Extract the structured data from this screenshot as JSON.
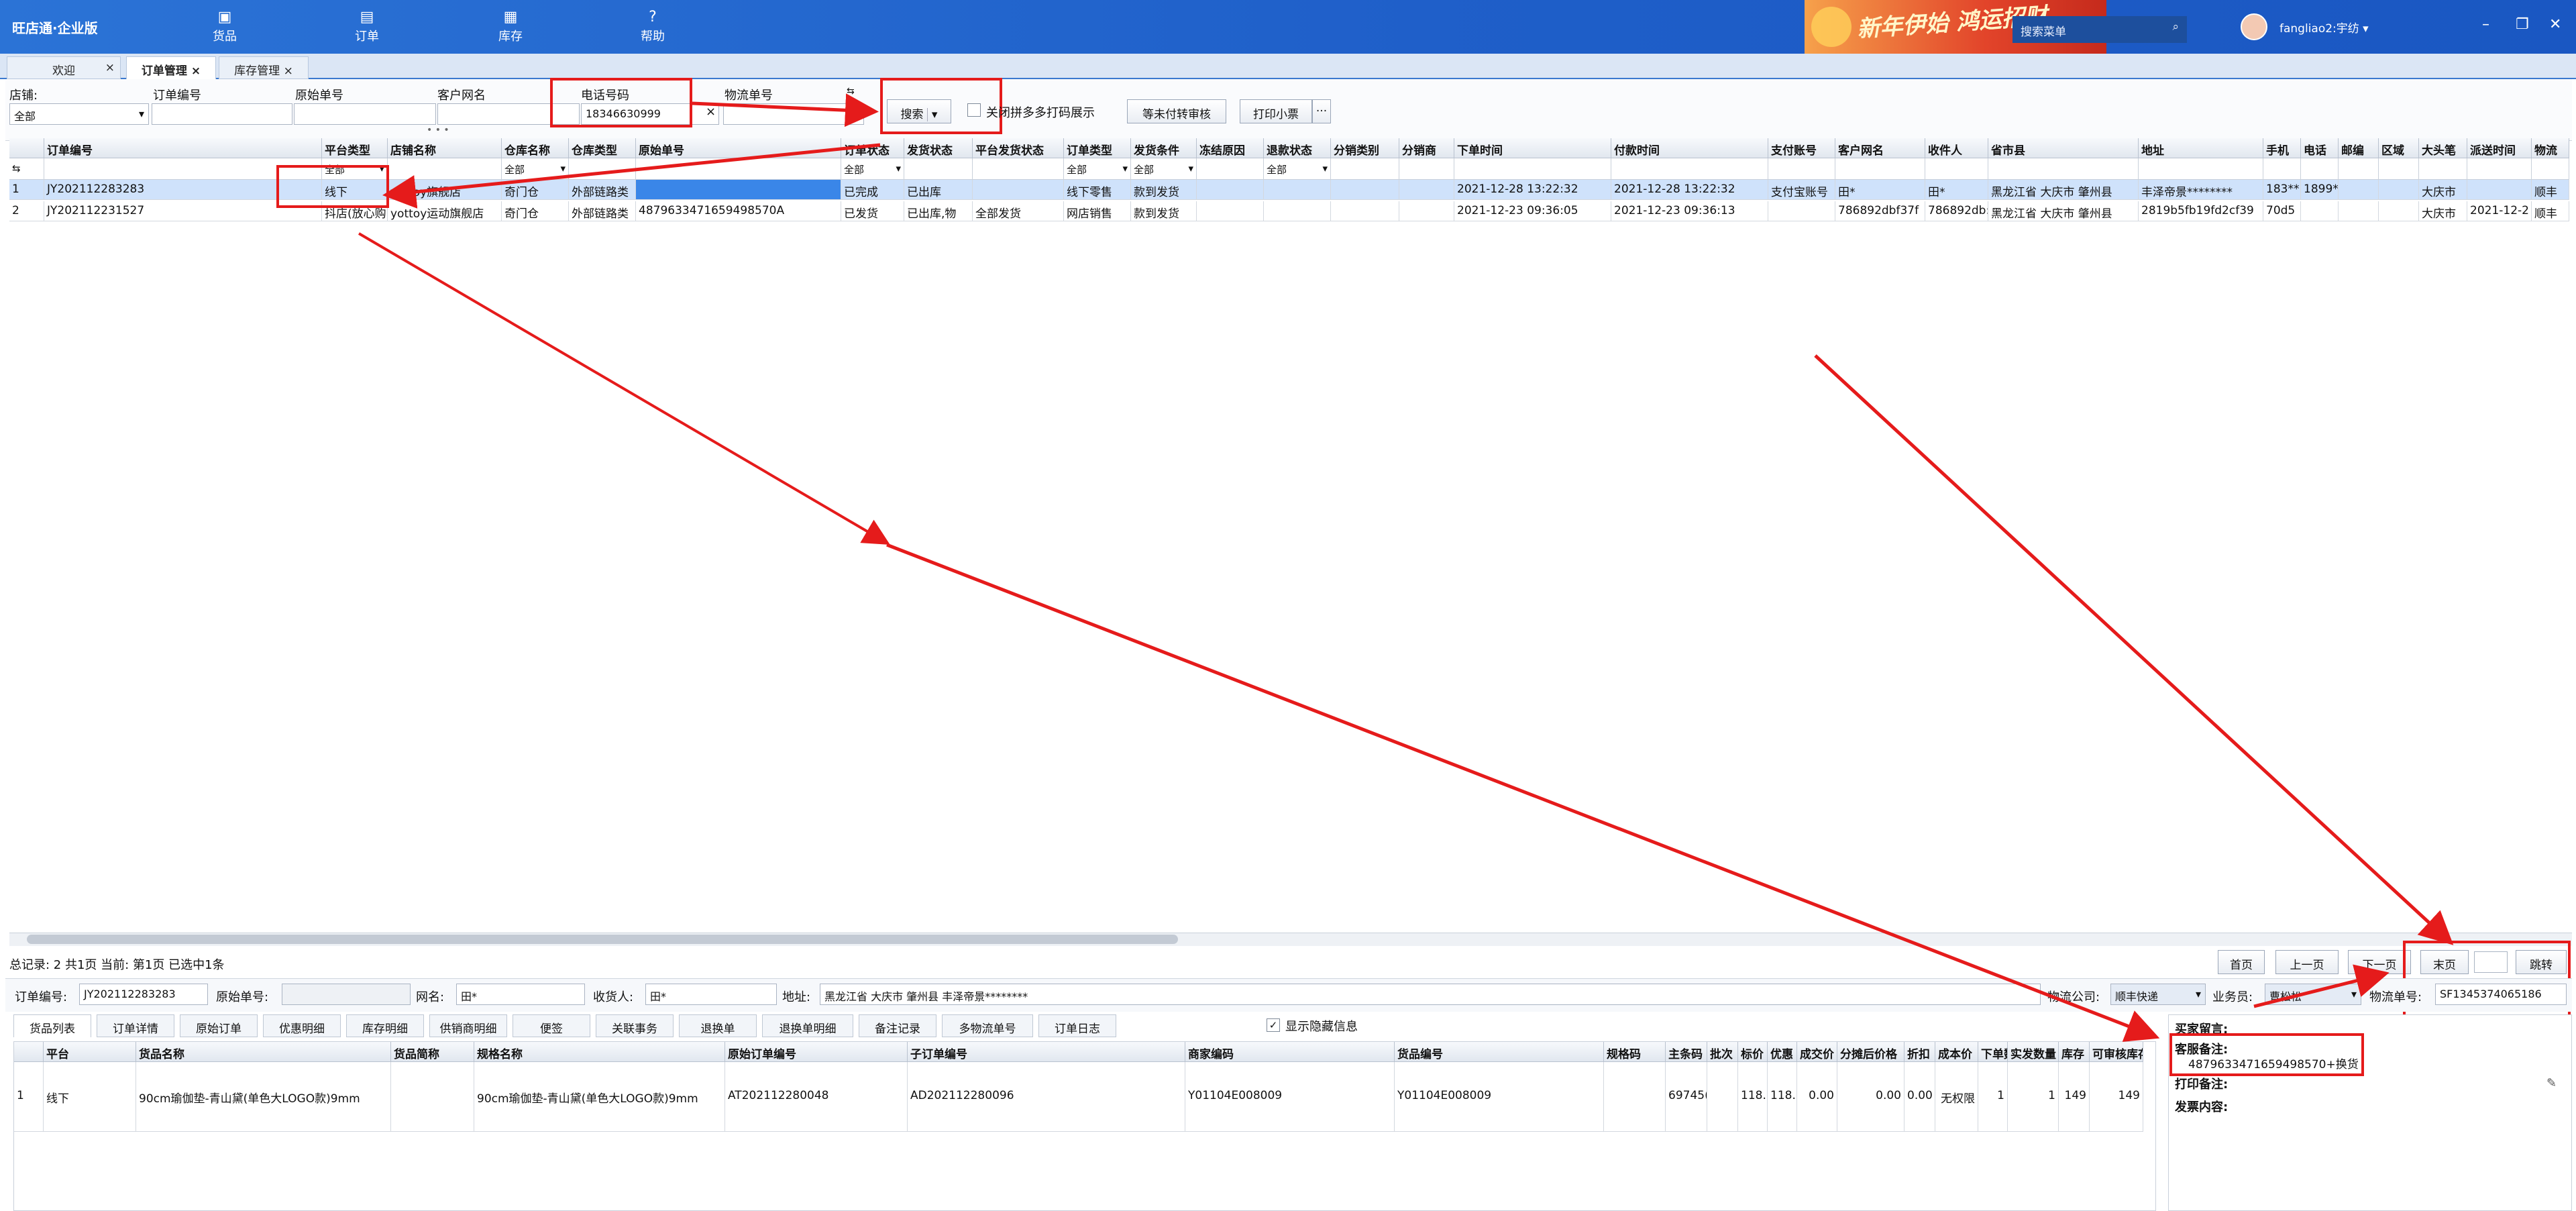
{
  "app": {
    "logo": "旺店通·企业版",
    "nav": [
      {
        "label": "货品",
        "icon": "goods-icon"
      },
      {
        "label": "订单",
        "icon": "order-icon"
      },
      {
        "label": "库存",
        "icon": "stock-icon"
      },
      {
        "label": "帮助",
        "icon": "help-icon"
      }
    ],
    "banner": "新年伊始 鸿运招财",
    "search_placeholder": "搜索菜单",
    "user": "fangliao2:宇纺"
  },
  "tabs": [
    {
      "label": "欢迎"
    },
    {
      "label": "订单管理"
    },
    {
      "label": "库存管理"
    }
  ],
  "filters": {
    "shop_label": "店铺:",
    "shop_value": "全部",
    "order_no_label": "订单编号",
    "orig_no_label": "原始单号",
    "customer_label": "客户网名",
    "phone_label": "电话号码",
    "phone_value": "18346630999",
    "logistics_label": "物流单号",
    "search_btn": "搜索",
    "checkbox_label": "关闭拼多多打码展示",
    "pending_btn": "等未付转审核",
    "print_btn": "打印小票",
    "more_btn": "···"
  },
  "grid": {
    "columns": [
      "订单编号",
      "平台类型",
      "店铺名称",
      "仓库名称",
      "仓库类型",
      "原始单号",
      "订单状态",
      "发货状态",
      "平台发货状态",
      "订单类型",
      "发货条件",
      "冻结原因",
      "退款状态",
      "分销类别",
      "分销商",
      "下单时间",
      "付款时间",
      "支付账号",
      "客户网名",
      "收件人",
      "省市县",
      "地址",
      "手机",
      "电话",
      "邮编",
      "区域",
      "大头笔",
      "派送时间",
      "物流"
    ],
    "filter_all": "全部",
    "rows": [
      [
        "1",
        "JY202112283283",
        "线下",
        "yottoy旗舰店",
        "奇门仓",
        "外部链路类",
        "",
        "已完成",
        "已出库",
        "",
        "线下零售",
        "款到发货",
        "",
        "",
        "",
        "",
        "2021-12-28 13:22:32",
        "2021-12-28 13:22:32",
        "支付宝账号",
        "田*",
        "田*",
        "黑龙江省 大庆市 肇州县",
        "丰泽帝景********",
        "183**",
        "1899*",
        "",
        "",
        "大庆市",
        "",
        "顺丰"
      ],
      [
        "2",
        "JY202112231527",
        "抖店(放心购)",
        "yottoy运动旗舰店",
        "奇门仓",
        "外部链路类",
        "4879633471659498570A",
        "已发货",
        "已出库,物",
        "全部发货",
        "网店销售",
        "款到发货",
        "",
        "",
        "",
        "",
        "2021-12-23 09:36:05",
        "2021-12-23 09:36:13",
        "",
        "786892dbf37f",
        "786892db:",
        "黑龙江省 大庆市 肇州县",
        "2819b5fb19fd2cf39",
        "70d5",
        "",
        "",
        "",
        "大庆市",
        "2021-12-2",
        "顺丰"
      ]
    ]
  },
  "status": {
    "summary": "总记录: 2 共1页 当前: 第1页 已选中1条",
    "first": "首页",
    "prev": "上一页",
    "next": "下一页",
    "last": "末页",
    "jump": "跳转"
  },
  "detail": {
    "order_no_label": "订单编号:",
    "order_no": "JY202112283283",
    "orig_label": "原始单号:",
    "orig": "",
    "net_label": "网名:",
    "net": "田*",
    "recv_label": "收货人:",
    "recv": "田*",
    "addr_label": "地址:",
    "addr": "黑龙江省 大庆市 肇州县 丰泽帝景********",
    "logi_company_label": "物流公司:",
    "logi_company": "顺丰快递",
    "sales_label": "业务员:",
    "sales": "曹松松",
    "logi_no_label": "物流单号:",
    "logi_no": "SF1345374065186"
  },
  "subtabs": [
    "货品列表",
    "订单详情",
    "原始订单",
    "优惠明细",
    "库存明细",
    "供销商明细",
    "便签",
    "关联事务",
    "退换单",
    "退换单明细",
    "备注记录",
    "多物流单号",
    "订单日志"
  ],
  "show_hidden": "显示隐藏信息",
  "items": {
    "columns": [
      "平台",
      "货品名称",
      "货品简称",
      "规格名称",
      "原始订单编号",
      "子订单编号",
      "商家编码",
      "货品编号",
      "规格码",
      "主条码",
      "批次",
      "标价",
      "优惠",
      "成交价",
      "分摊后价格",
      "折扣",
      "成本价",
      "下单数",
      "实发数量",
      "库存",
      "可审核库存"
    ],
    "row": [
      "1",
      "线下",
      "90cm瑜伽垫-青山黛(单色大LOGO款)9mm",
      "",
      "90cm瑜伽垫-青山黛(单色大LOGO款)9mm",
      "AT202112280048",
      "AD202112280096",
      "Y01104E008009",
      "Y01104E008009",
      "",
      "69745(",
      "",
      "118.0",
      "118.0",
      "0.00",
      "0.00",
      "0.00",
      "无权限",
      "1",
      "1",
      "149",
      "149"
    ]
  },
  "notes": {
    "buyer": "买家留言:",
    "cs": "客服备注:",
    "cs_value": "4879633471659498570+换货",
    "print": "打印备注:",
    "invoice": "发票内容:"
  }
}
